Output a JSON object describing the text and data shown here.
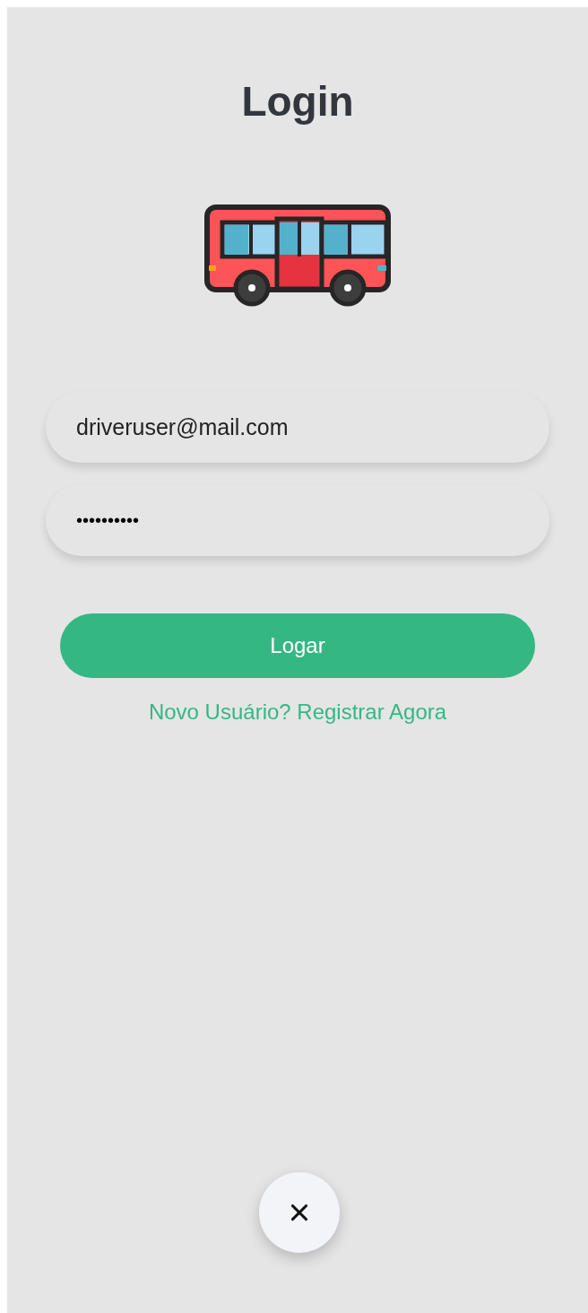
{
  "title": "Login",
  "email_field": {
    "value": "driveruser@mail.com"
  },
  "password_field": {
    "value": "••••••••••"
  },
  "login_button": {
    "label": "Logar"
  },
  "register_link": {
    "label": "Novo Usuário? Registrar Agora"
  }
}
